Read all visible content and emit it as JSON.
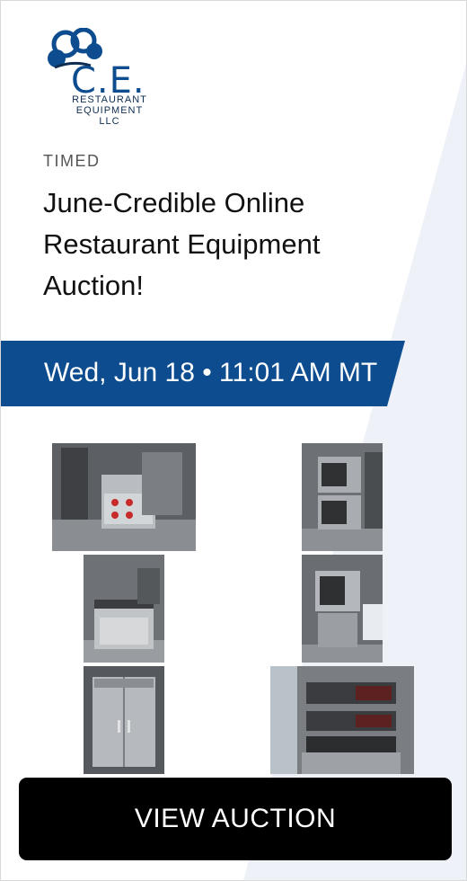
{
  "logo": {
    "mark": "C.E.",
    "line1": "RESTAURANT",
    "line2": "EQUIPMENT",
    "line3": "LLC",
    "brand_color": "#0d4d8f"
  },
  "auction": {
    "type_label": "TIMED",
    "title": "June-Credible Online Restaurant Equipment Auction!",
    "date_time": "Wed, Jun 18 • 11:01 AM MT",
    "band_color": "#0d4d8f"
  },
  "gallery": {
    "items": [
      {
        "subject": "stainless range with red knobs"
      },
      {
        "subject": "double stack convection oven"
      },
      {
        "subject": "gas range with oven"
      },
      {
        "subject": "convection oven on stand"
      },
      {
        "subject": "two-door reach-in refrigerator"
      },
      {
        "subject": "stacked conveyor pizza oven"
      }
    ]
  },
  "cta": {
    "label": "VIEW AUCTION"
  }
}
